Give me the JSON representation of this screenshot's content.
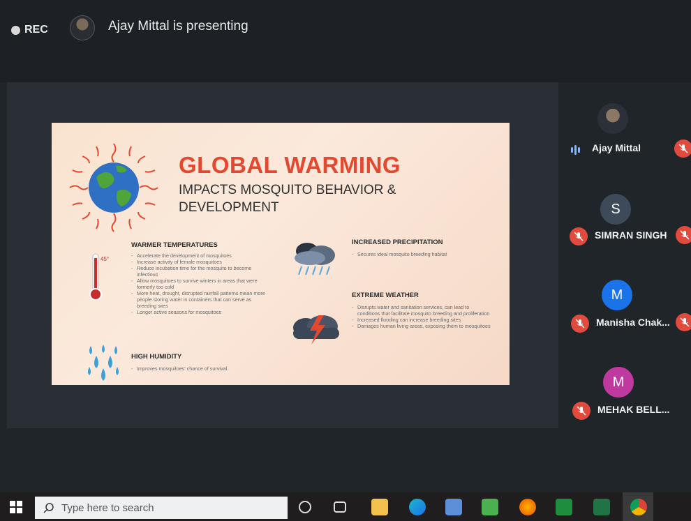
{
  "meeting": {
    "rec_label": "REC",
    "presenter_text": "Ajay Mittal is presenting"
  },
  "slide": {
    "title": "GLOBAL WARMING",
    "subtitle": "IMPACTS MOSQUITO BEHAVIOR & DEVELOPMENT",
    "thermometer_label": "45°",
    "sections": {
      "warmer": {
        "heading": "WARMER TEMPERATURES",
        "bullets": [
          "Accelerate the development of mosquitoes",
          "Increase activity of female mosquitoes",
          "Reduce incubation time for the mosquito to become infectious",
          "Allow mosquitoes to survive winters in areas that were formerly too cold",
          "More heat, drought, disrupted rainfall patterns mean more people storing water in containers that can serve as breeding sites",
          "Longer active seasons for mosquitoes"
        ]
      },
      "humidity": {
        "heading": "HIGH HUMIDITY",
        "bullets": [
          "Improves mosquitoes' chance of survival"
        ]
      },
      "precipitation": {
        "heading": "INCREASED PRECIPITATION",
        "bullets": [
          "Secures ideal mosquito breeding habitat"
        ]
      },
      "extreme": {
        "heading": "EXTREME WEATHER",
        "bullets": [
          "Disrupts water and sanitation services, can lead to conditions that facilitate mosquito breeding and proliferation",
          "Increased flooding can increase breeding sites",
          "Damages human living areas, exposing them to mosquitoes"
        ]
      }
    }
  },
  "participants": [
    {
      "name": "Ajay Mittal",
      "initial": "",
      "avatar_color": "#3c4043",
      "status": "speaking"
    },
    {
      "name": "SIMRAN SINGH",
      "initial": "S",
      "avatar_color": "#3c4a5a",
      "status": "muted"
    },
    {
      "name": "Manisha Chak...",
      "initial": "M",
      "avatar_color": "#1a73e8",
      "status": "muted"
    },
    {
      "name": "MEHAK BELL...",
      "initial": "M",
      "avatar_color": "#c0399f",
      "status": "muted"
    }
  ],
  "taskbar": {
    "search_placeholder": "Type here to search",
    "icons": [
      "cortana-icon",
      "task-view-icon",
      "file-explorer-icon",
      "edge-icon",
      "store-icon",
      "app-icon",
      "firefox-icon",
      "docs-icon",
      "excel-icon",
      "chrome-icon"
    ]
  },
  "colors": {
    "title_red": "#e2492f",
    "mute_red": "#e04b3d",
    "accent_blue": "#1a73e8"
  }
}
